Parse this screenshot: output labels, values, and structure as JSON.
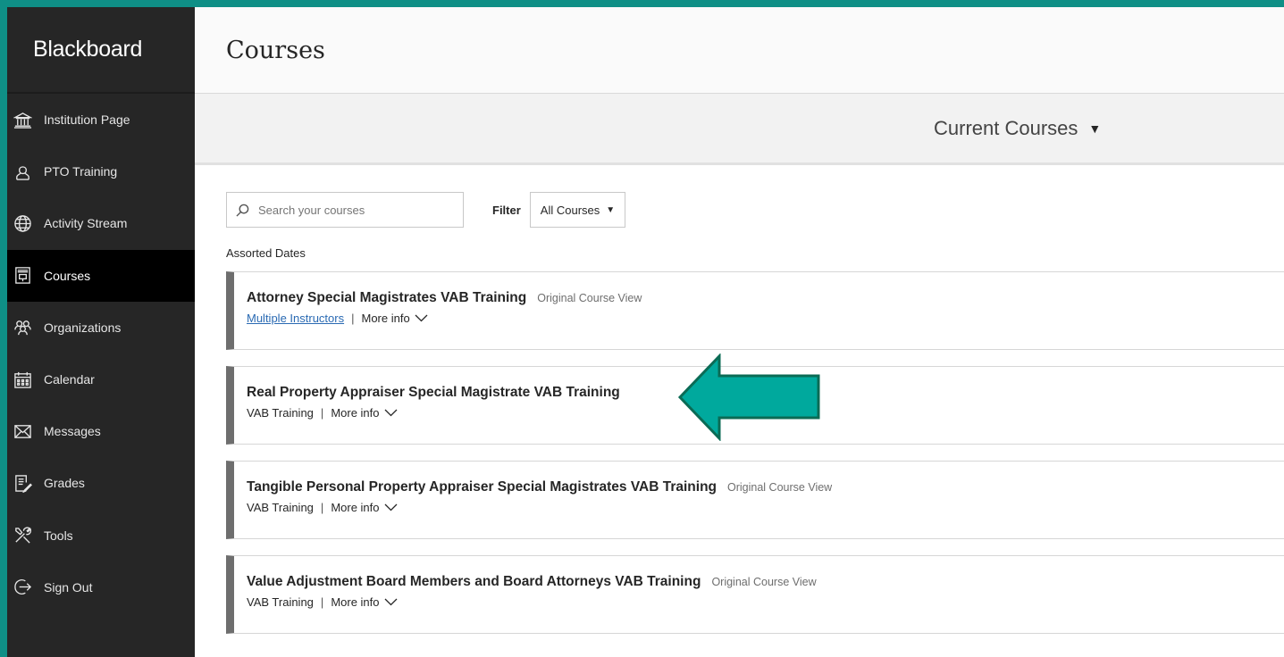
{
  "brand": "Blackboard",
  "sidebar": {
    "items": [
      {
        "label": "Institution Page",
        "icon": "institution-icon"
      },
      {
        "label": "PTO Training",
        "icon": "user-icon"
      },
      {
        "label": "Activity Stream",
        "icon": "globe-icon"
      },
      {
        "label": "Courses",
        "icon": "courses-icon",
        "active": true
      },
      {
        "label": "Organizations",
        "icon": "organizations-icon"
      },
      {
        "label": "Calendar",
        "icon": "calendar-icon"
      },
      {
        "label": "Messages",
        "icon": "envelope-icon"
      },
      {
        "label": "Grades",
        "icon": "grades-icon"
      },
      {
        "label": "Tools",
        "icon": "tools-icon"
      },
      {
        "label": "Sign Out",
        "icon": "sign-out-icon"
      }
    ]
  },
  "header": {
    "title": "Courses"
  },
  "term": {
    "label": "Current Courses",
    "caret": "▼"
  },
  "filters": {
    "search_placeholder": "Search your courses",
    "filter_label": "Filter",
    "filter_value": "All Courses",
    "caret": "▼"
  },
  "section_label": "Assorted Dates",
  "courses": [
    {
      "title": "Attorney Special Magistrates VAB Training",
      "view": "Original Course View",
      "meta": "Multiple Instructors",
      "more": "More info"
    },
    {
      "title": "Real Property Appraiser Special Magistrate VAB Training",
      "view": "",
      "meta": "VAB Training",
      "more": "More info"
    },
    {
      "title": "Tangible Personal Property Appraiser Special Magistrates VAB Training",
      "view": "Original Course View",
      "meta": "VAB Training",
      "more": "More info"
    },
    {
      "title": "Value Adjustment Board Members and Board Attorneys VAB Training",
      "view": "Original Course View",
      "meta": "VAB Training",
      "more": "More info"
    }
  ],
  "separator": "|",
  "colors": {
    "accent_arrow": "#00a99d",
    "arrow_outline": "#0b6b55",
    "sidebar_bg": "#262626",
    "link": "#2a6ab3"
  }
}
